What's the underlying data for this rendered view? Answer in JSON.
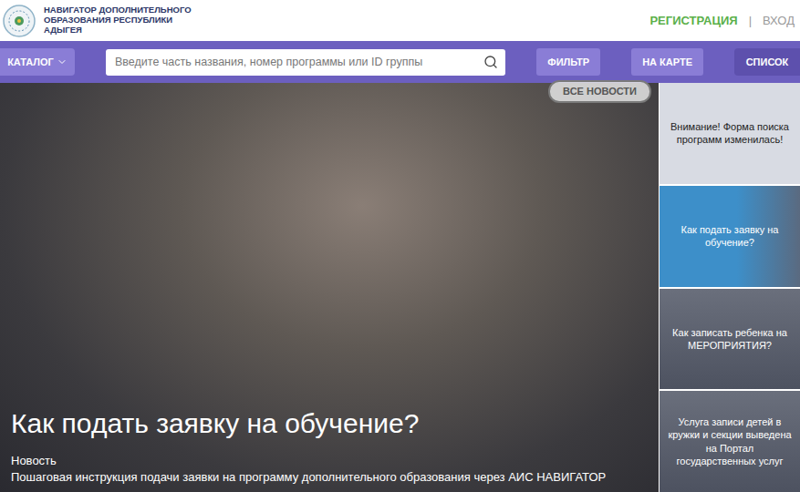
{
  "header": {
    "logo_lines": [
      "НАВИГАТОР ДОПОЛНИТЕЛЬНОГО",
      "ОБРАЗОВАНИЯ РЕСПУБЛИКИ",
      "АДЫГЕЯ"
    ],
    "register": "РЕГИСТРАЦИЯ",
    "separator": "|",
    "login": "ВХОД"
  },
  "toolbar": {
    "catalog": "КАТАЛОГ",
    "search": {
      "placeholder": "Введите часть названия, номер программы или ID группы"
    },
    "buttons": [
      {
        "label": "ФИЛЬТР",
        "selected": false
      },
      {
        "label": "НА КАРТЕ",
        "selected": false
      },
      {
        "label": "СПИСОК",
        "selected": true
      }
    ]
  },
  "hero": {
    "all_news": "ВСЕ НОВОСТИ",
    "title": "Как подать заявку на обучение?",
    "category": "Новость",
    "description": "Пошаговая инструкция подачи заявки на программу дополнительного образования через АИС НАВИГАТОР"
  },
  "news_list": [
    {
      "title": "Внимание! Форма поиска программ изменилась!",
      "kind": "light",
      "selected": false
    },
    {
      "title": "Как подать заявку на обучение?",
      "kind": "photo",
      "selected": true
    },
    {
      "title": "Как записать ребенка на МЕРОПРИЯТИЯ?",
      "kind": "photo",
      "selected": false
    },
    {
      "title": "Услуга записи детей в кружки и секции выведена на Портал государственных услуг",
      "kind": "photo",
      "selected": false
    }
  ]
}
